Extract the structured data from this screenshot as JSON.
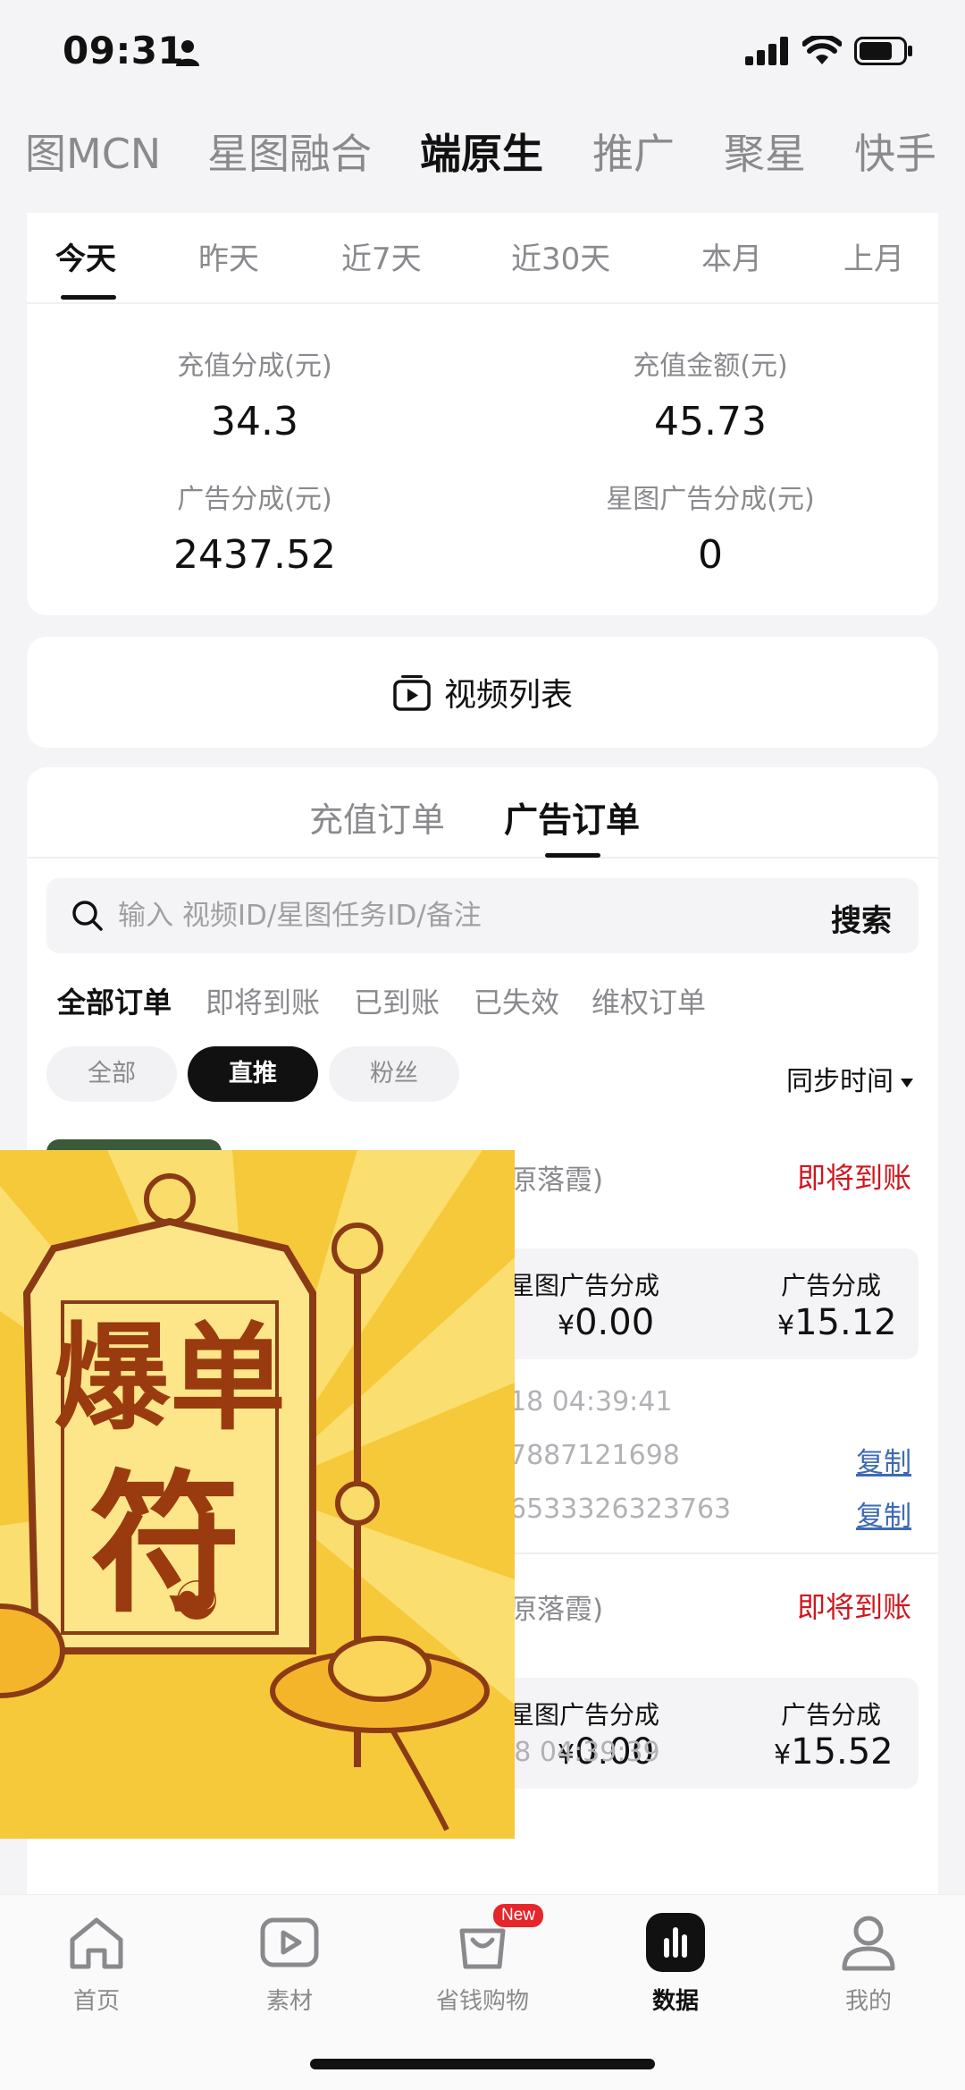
{
  "status_bar": {
    "time": "09:31",
    "icons": [
      "person-icon",
      "signal-icon",
      "wifi-icon",
      "battery-icon"
    ]
  },
  "platform_tabs": [
    {
      "label": "图MCN",
      "active": false
    },
    {
      "label": "星图融合",
      "active": false
    },
    {
      "label": "端原生",
      "active": true
    },
    {
      "label": "推广",
      "active": false
    },
    {
      "label": "聚星",
      "active": false
    },
    {
      "label": "快手",
      "active": false
    }
  ],
  "date_tabs": [
    {
      "label": "今天",
      "active": true
    },
    {
      "label": "昨天",
      "active": false
    },
    {
      "label": "近7天",
      "active": false
    },
    {
      "label": "近30天",
      "active": false
    },
    {
      "label": "本月",
      "active": false
    },
    {
      "label": "上月",
      "active": false
    }
  ],
  "stats": [
    {
      "label": "充值分成(元)",
      "value": "34.3"
    },
    {
      "label": "充值金额(元)",
      "value": "45.73"
    },
    {
      "label": "广告分成(元)",
      "value": "2437.52"
    },
    {
      "label": "星图广告分成(元)",
      "value": "0"
    }
  ],
  "video_list": {
    "label": "视频列表"
  },
  "order_type_tabs": [
    {
      "label": "充值订单",
      "active": false
    },
    {
      "label": "广告订单",
      "active": true
    }
  ],
  "search": {
    "placeholder": "输入 视频ID/星图任务ID/备注",
    "button": "搜索"
  },
  "status_filters": [
    {
      "label": "全部订单",
      "active": true
    },
    {
      "label": "即将到账",
      "active": false
    },
    {
      "label": "已到账",
      "active": false
    },
    {
      "label": "已失效",
      "active": false
    },
    {
      "label": "维权订单",
      "active": false
    }
  ],
  "chips": [
    {
      "label": "全部",
      "active": false
    },
    {
      "label": "直推",
      "active": true
    },
    {
      "label": "粉丝",
      "active": false
    }
  ],
  "sort": {
    "label": "同步时间"
  },
  "orders": [
    {
      "author": "原落霞)",
      "status": "即将到账",
      "metric1_label": "星图广告分成",
      "metric1_currency": "¥",
      "metric1_value": "0.00",
      "metric2_label": "广告分成",
      "metric2_currency": "¥",
      "metric2_value": "15.12",
      "sync_time": "18 04:39:41",
      "id1": "7887121698",
      "id2": "6533326323763",
      "copy_label": "复制"
    },
    {
      "author": "原落霞)",
      "status": "即将到账",
      "metric1_label": "星图广告分成",
      "metric1_currency": "¥",
      "metric1_value": "0.00",
      "metric2_label": "广告分成",
      "metric2_currency": "¥",
      "metric2_value": "15.52",
      "sync_time": "同步时间：2026-05-18 04:39:39"
    }
  ],
  "sticker": {
    "text_line1": "爆单",
    "text_line2": "符",
    "center_glyph": "☯"
  },
  "bottom_nav": [
    {
      "label": "首页",
      "icon": "home-icon",
      "active": false
    },
    {
      "label": "素材",
      "icon": "play-icon",
      "active": false
    },
    {
      "label": "省钱购物",
      "icon": "shopping-bag-icon",
      "active": false,
      "badge": "New"
    },
    {
      "label": "数据",
      "icon": "chart-icon",
      "active": true
    },
    {
      "label": "我的",
      "icon": "profile-icon",
      "active": false
    }
  ],
  "colors": {
    "accent_red": "#d0161e",
    "link_blue": "#3d6ab5",
    "badge_red": "#e5262b",
    "sticker_yellow": "#f6c93a",
    "sticker_brown": "#8a3a14"
  }
}
